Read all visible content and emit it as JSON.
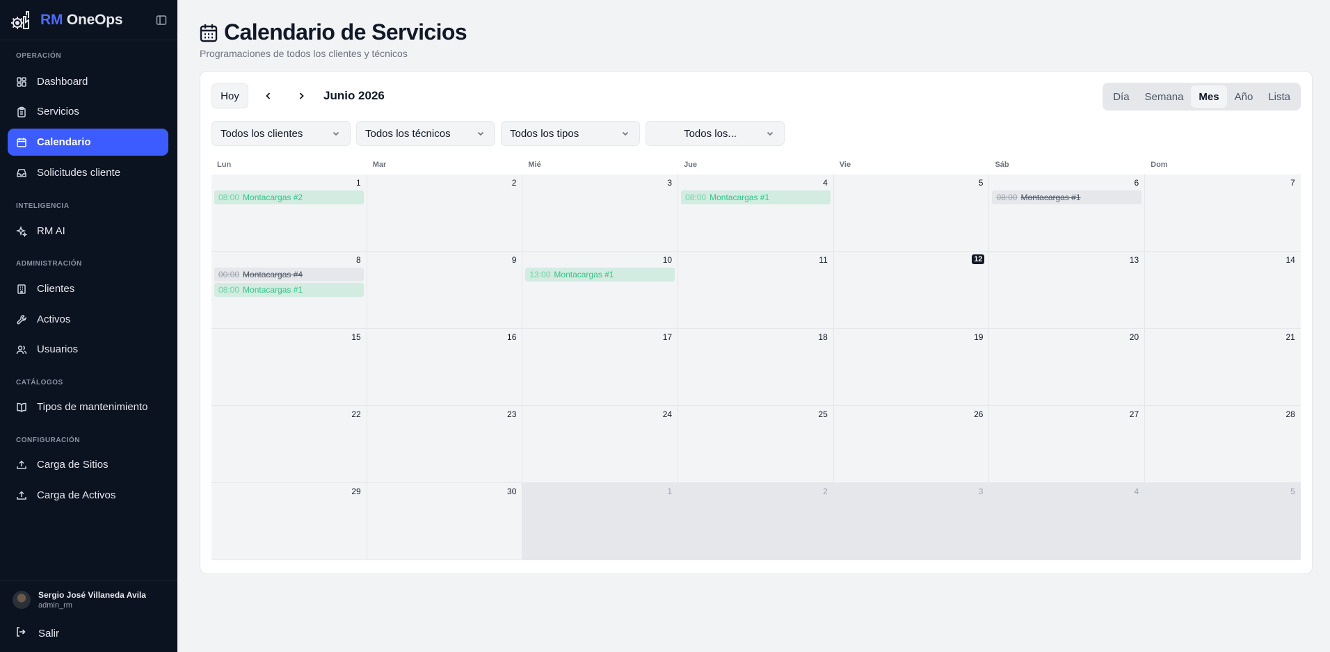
{
  "brand": {
    "rm": "RM",
    "ops": "OneOps"
  },
  "sidebar": {
    "sections": [
      {
        "title": "OPERACIÓN",
        "items": [
          {
            "label": "Dashboard",
            "icon": "dashboard-icon"
          },
          {
            "label": "Servicios",
            "icon": "clipboard-icon"
          },
          {
            "label": "Calendario",
            "icon": "calendar-icon",
            "active": true
          },
          {
            "label": "Solicitudes cliente",
            "icon": "inbox-icon"
          }
        ]
      },
      {
        "title": "INTELIGENCIA",
        "items": [
          {
            "label": "RM AI",
            "icon": "sparkles-icon"
          }
        ]
      },
      {
        "title": "ADMINISTRACIÓN",
        "items": [
          {
            "label": "Clientes",
            "icon": "building-icon"
          },
          {
            "label": "Activos",
            "icon": "wrench-icon"
          },
          {
            "label": "Usuarios",
            "icon": "users-icon"
          }
        ]
      },
      {
        "title": "CATÁLOGOS",
        "items": [
          {
            "label": "Tipos de mantenimiento",
            "icon": "book-icon"
          }
        ]
      },
      {
        "title": "CONFIGURACIÓN",
        "items": [
          {
            "label": "Carga de Sitios",
            "icon": "upload-icon"
          },
          {
            "label": "Carga de Activos",
            "icon": "upload-icon"
          }
        ]
      }
    ],
    "user": {
      "name": "Sergio José Villaneda Avila",
      "handle": "admin_rm"
    },
    "logout": "Salir"
  },
  "page": {
    "title": "Calendario de Servicios",
    "subtitle": "Programaciones de todos los clientes y técnicos"
  },
  "toolbar": {
    "today": "Hoy",
    "month": "Junio 2026",
    "views": [
      "Día",
      "Semana",
      "Mes",
      "Año",
      "Lista"
    ],
    "active_view": "Mes"
  },
  "filters": {
    "clientes": "Todos los clientes",
    "tecnicos": "Todos los técnicos",
    "tipos": "Todos los tipos",
    "estados": "Todos los..."
  },
  "calendar": {
    "days_of_week": [
      "Lun",
      "Mar",
      "Mié",
      "Jue",
      "Vie",
      "Sáb",
      "Dom"
    ],
    "weeks": [
      [
        {
          "day": "1",
          "events": [
            {
              "time": "08:00",
              "name": "Montacargas #2",
              "status": "ok"
            }
          ]
        },
        {
          "day": "2",
          "events": []
        },
        {
          "day": "3",
          "events": []
        },
        {
          "day": "4",
          "events": [
            {
              "time": "08:00",
              "name": "Montacargas #1",
              "status": "ok"
            }
          ]
        },
        {
          "day": "5",
          "events": []
        },
        {
          "day": "6",
          "events": [
            {
              "time": "08:00",
              "name": "Montacargas #1",
              "status": "cancel"
            }
          ]
        },
        {
          "day": "7",
          "events": []
        }
      ],
      [
        {
          "day": "8",
          "events": [
            {
              "time": "00:00",
              "name": "Montacargas #4",
              "status": "cancel"
            },
            {
              "time": "08:00",
              "name": "Montacargas #1",
              "status": "ok"
            }
          ]
        },
        {
          "day": "9",
          "events": []
        },
        {
          "day": "10",
          "events": [
            {
              "time": "13:00",
              "name": "Montacargas #1",
              "status": "ok"
            }
          ]
        },
        {
          "day": "11",
          "events": []
        },
        {
          "day": "12",
          "today": true,
          "events": []
        },
        {
          "day": "13",
          "events": []
        },
        {
          "day": "14",
          "events": []
        }
      ],
      [
        {
          "day": "15",
          "events": []
        },
        {
          "day": "16",
          "events": []
        },
        {
          "day": "17",
          "events": []
        },
        {
          "day": "18",
          "events": []
        },
        {
          "day": "19",
          "events": []
        },
        {
          "day": "20",
          "events": []
        },
        {
          "day": "21",
          "events": []
        }
      ],
      [
        {
          "day": "22",
          "events": []
        },
        {
          "day": "23",
          "events": []
        },
        {
          "day": "24",
          "events": []
        },
        {
          "day": "25",
          "events": []
        },
        {
          "day": "26",
          "events": []
        },
        {
          "day": "27",
          "events": []
        },
        {
          "day": "28",
          "events": []
        }
      ],
      [
        {
          "day": "29",
          "events": []
        },
        {
          "day": "30",
          "events": []
        },
        {
          "day": "1",
          "other": true,
          "events": []
        },
        {
          "day": "2",
          "other": true,
          "events": []
        },
        {
          "day": "3",
          "other": true,
          "events": []
        },
        {
          "day": "4",
          "other": true,
          "events": []
        },
        {
          "day": "5",
          "other": true,
          "events": []
        }
      ]
    ]
  },
  "colors": {
    "accent": "#3c5cff",
    "sidebar_bg": "#0b1220",
    "event_ok_bg": "#d2ece1",
    "event_ok_text": "#34c28a"
  }
}
